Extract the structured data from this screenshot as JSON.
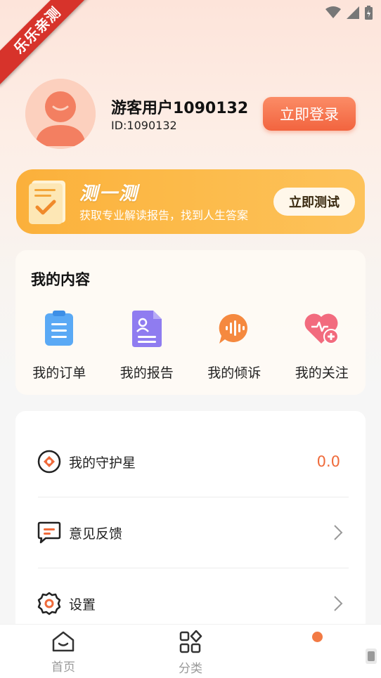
{
  "watermark": "乐乐亲测",
  "profile": {
    "username": "游客用户1090132",
    "user_id": "ID:1090132",
    "login_label": "立即登录"
  },
  "banner": {
    "title": "测一测",
    "subtitle": "获取专业解读报告，找到人生答案",
    "button_label": "立即测试"
  },
  "my_content": {
    "title": "我的内容",
    "items": [
      {
        "label": "我的订单",
        "icon": "clipboard-icon"
      },
      {
        "label": "我的报告",
        "icon": "report-icon"
      },
      {
        "label": "我的倾诉",
        "icon": "voice-bubble-icon"
      },
      {
        "label": "我的关注",
        "icon": "heart-plus-icon"
      }
    ]
  },
  "menu": {
    "guardian": {
      "label": "我的守护星",
      "value": "0.0"
    },
    "feedback": {
      "label": "意见反馈"
    },
    "settings": {
      "label": "设置"
    }
  },
  "tabbar": {
    "home": "首页",
    "category": "分类"
  },
  "colors": {
    "accent": "#f2643f",
    "banner": "#fbb03b",
    "value": "#ef6a3a"
  }
}
